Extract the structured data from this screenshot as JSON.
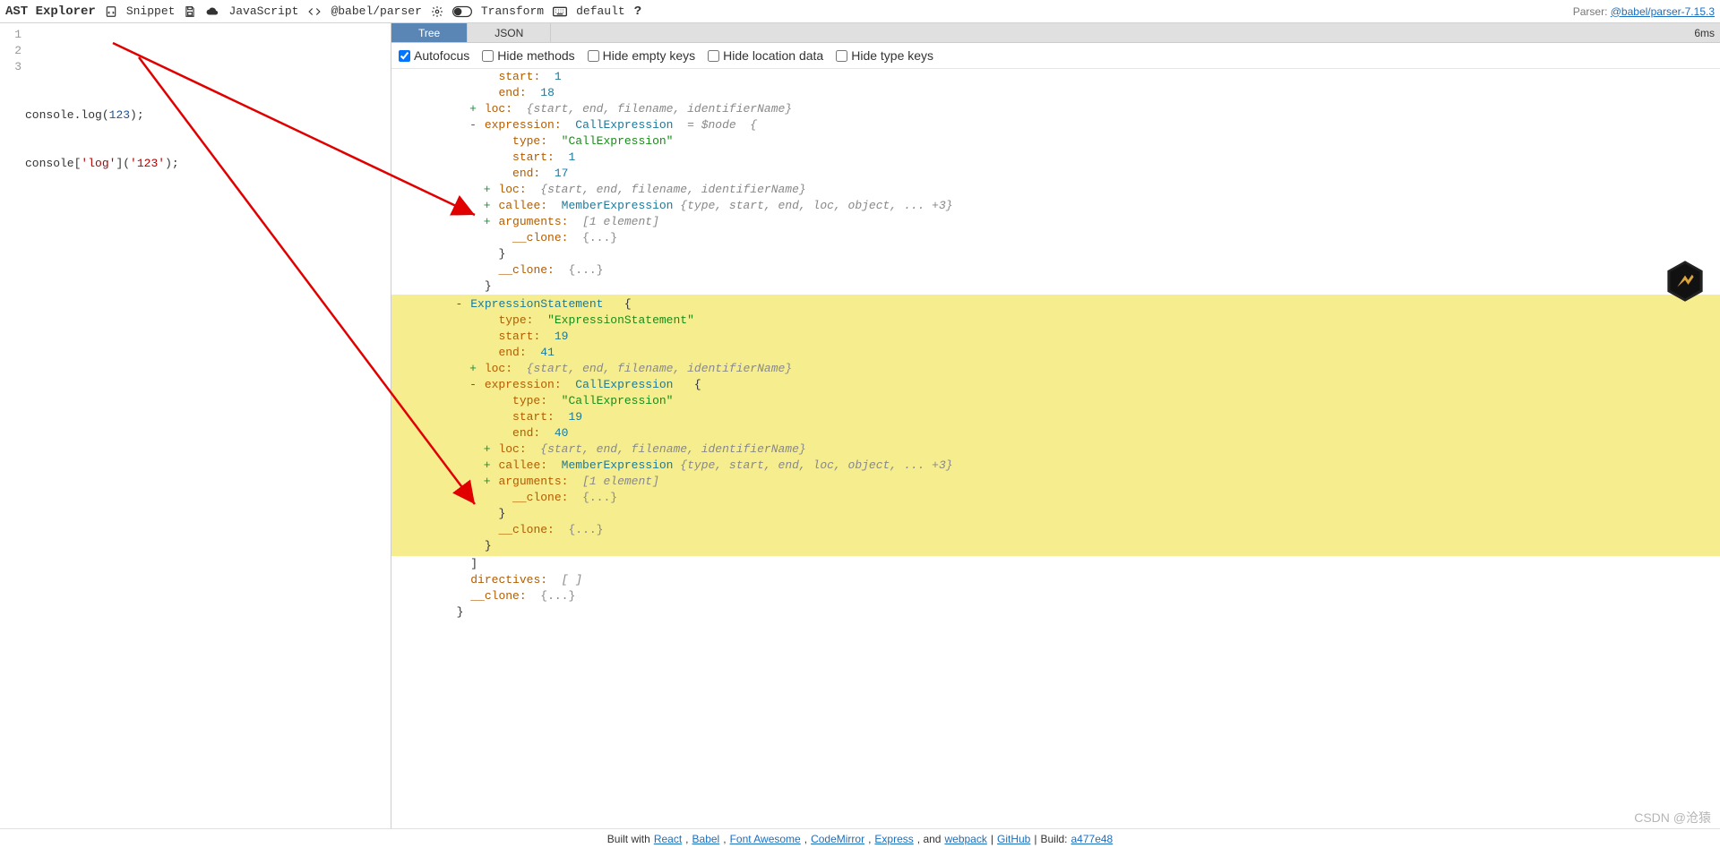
{
  "toolbar": {
    "brand": "AST Explorer",
    "snippet": "Snippet",
    "language": "JavaScript",
    "parser": "@babel/parser",
    "transform": "Transform",
    "default": "default",
    "parser_label": "Parser:",
    "parser_link": "@babel/parser-7.15.3"
  },
  "editor": {
    "lines": [
      "1",
      "2",
      "3"
    ],
    "line1_prefix": "",
    "line2": {
      "a": "console.",
      "b": "log",
      "c": "(",
      "d": "123",
      "e": ");"
    },
    "line3": {
      "a": "console[",
      "b": "'log'",
      "c": "](",
      "d": "'123'",
      "e": ");"
    }
  },
  "tabs": {
    "tree": "Tree",
    "json": "JSON",
    "time": "6ms"
  },
  "options": {
    "autofocus": "Autofocus",
    "hide_methods": "Hide methods",
    "hide_empty": "Hide empty keys",
    "hide_loc": "Hide location data",
    "hide_type": "Hide type keys"
  },
  "ast": {
    "start_key": "start:",
    "start_val": "1",
    "end_key": "end:",
    "end_val": "18",
    "loc_key": "loc:",
    "loc_val": "{start, end, filename, identifierName}",
    "expression_key": "expression:",
    "expression_type": "CallExpression",
    "eq_node": "= $node  {",
    "type_key": "type:",
    "type_val": "\"CallExpression\"",
    "start2": "1",
    "end2": "17",
    "callee_key": "callee:",
    "callee_type": "MemberExpression",
    "callee_gray": "{type, start, end, loc, object, ... +3}",
    "arguments_key": "arguments:",
    "arguments_val": "[1 element]",
    "clone_key": "__clone:",
    "clone_val": "{...}",
    "es_label": "ExpressionStatement",
    "es_brace": "{",
    "type_es": "\"ExpressionStatement\"",
    "start3": "19",
    "end3": "41",
    "start4": "19",
    "end4": "40",
    "directives_key": "directives:",
    "directives_val": "[ ]"
  },
  "footer": {
    "built": "Built with",
    "react": "React",
    "babel": "Babel",
    "fa": "Font Awesome",
    "cm": "CodeMirror",
    "express": "Express",
    "and": ", and",
    "webpack": "webpack",
    "sep": "|",
    "gh": "GitHub",
    "sep2": "|",
    "build_label": "Build:",
    "build": "a477e48"
  },
  "watermark": "CSDN @沧猿"
}
